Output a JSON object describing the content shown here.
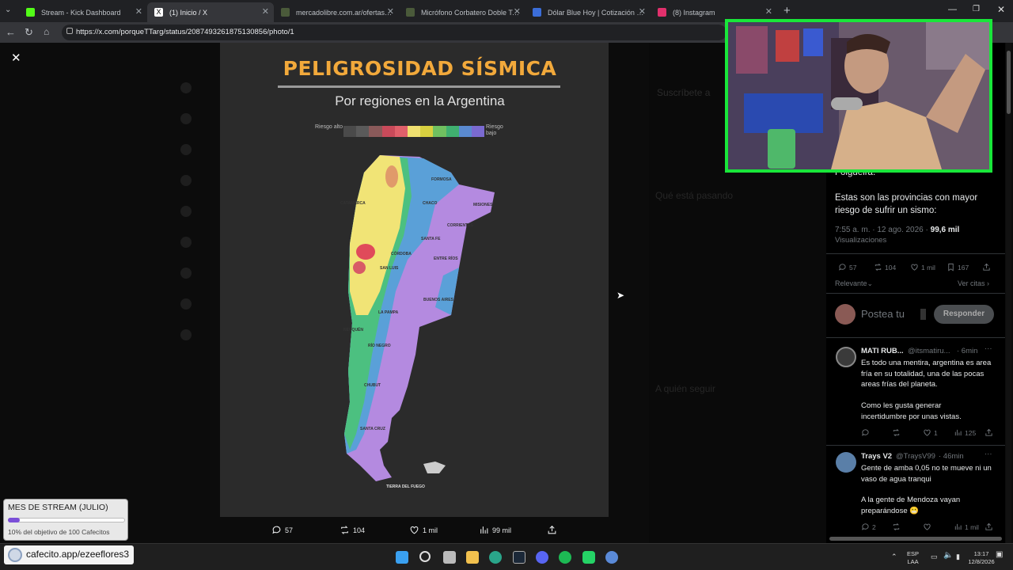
{
  "tabs": [
    {
      "label": "Stream - Kick Dashboard",
      "fav": "#53fc18"
    },
    {
      "label": "(1) Inicio / X",
      "fav": "#ffffff"
    },
    {
      "label": "mercadolibre.com.ar/ofertas?cont",
      "fav": "#4a5a3a"
    },
    {
      "label": "Micrófono Corbatero Doble Tema",
      "fav": "#4a5a3a"
    },
    {
      "label": "Dólar Blue Hoy | Cotización Dólar",
      "fav": "#3b6dd8"
    },
    {
      "label": "(8) Instagram",
      "fav": "#e1306c"
    }
  ],
  "address": {
    "url": "https://x.com/porqueTTarg/status/2087493261875130856/photo/1"
  },
  "image": {
    "title": "PELIGROSIDAD SÍSMICA",
    "subtitle": "Por regiones en la Argentina",
    "legend_high": "Riesgo alto",
    "legend_low": "Riesgo bajo",
    "legend_colors": [
      "#4a4a4a",
      "#5a5a5a",
      "#8a5a5a",
      "#c94a5a",
      "#e0606a",
      "#f0e070",
      "#d8d040",
      "#70c060",
      "#40b070",
      "#5a8ad0",
      "#7a6ad0"
    ],
    "provinces": [
      "FORMOSA",
      "CATAMARCA",
      "CHACO",
      "MISIONES",
      "CORRIENTES",
      "SANTA FE",
      "ENTRE RÍOS",
      "CÓRDOBA",
      "SAN LUIS",
      "BUENOS AIRES",
      "LA PAMPA",
      "NEUQUÉN",
      "RÍO NEGRO",
      "CHUBUT",
      "SANTA CRUZ",
      "TIERRA DEL FUEGO"
    ]
  },
  "media_actions": {
    "replies": "57",
    "reposts": "104",
    "likes": "1 mil",
    "views": "99 mil"
  },
  "post": {
    "partial_line": "Folgueira.",
    "body": "Estas son las provincias con mayor riesgo de sufrir un sismo:",
    "timestamp": "7:55 a. m. · 12 ago. 2026 ·",
    "views_count": "99,6 mil",
    "views_label": "Visualizaciones",
    "stats": {
      "replies": "57",
      "reposts": "104",
      "likes": "1 mil",
      "bookmarks": "167"
    },
    "sort_label": "Relevante",
    "quotes_label": "Ver citas",
    "compose_placeholder": "Postea tu",
    "reply_button": "Responder"
  },
  "replies": [
    {
      "name": "MATI RUB...",
      "handle": "@itsmatiru...",
      "time": "· 6min",
      "body1": "Es todo una mentira, argentina es area fría en su totalidad, una de las pocas areas frías del planeta.",
      "body2": "Como les gusta generar incertidumbre por unas vistas.",
      "likes": "1",
      "views": "125"
    },
    {
      "name": "Trays V2",
      "handle": "@TraysV99",
      "time": "· 46min",
      "body1": "Gente de amba 0,05 no te mueve ni un vaso de agua tranqui",
      "body2": "A la gente de Mendoza vayan preparándose 😬",
      "replies": "2",
      "views": "1 mil"
    }
  ],
  "background_ghost": {
    "subscribe": "Suscríbete a",
    "trending": "Qué está pasando",
    "follow": "A quién seguir"
  },
  "goal": {
    "title": "MES DE STREAM (JULIO)",
    "subtitle": "10% del objetivo de 100 Cafecitos",
    "progress": 0.1
  },
  "taskbar": {
    "cafecito": "cafecito.app/ezeeflores3",
    "lang1": "ESP",
    "lang2": "LAA",
    "time": "13:17",
    "date": "12/8/2026"
  }
}
